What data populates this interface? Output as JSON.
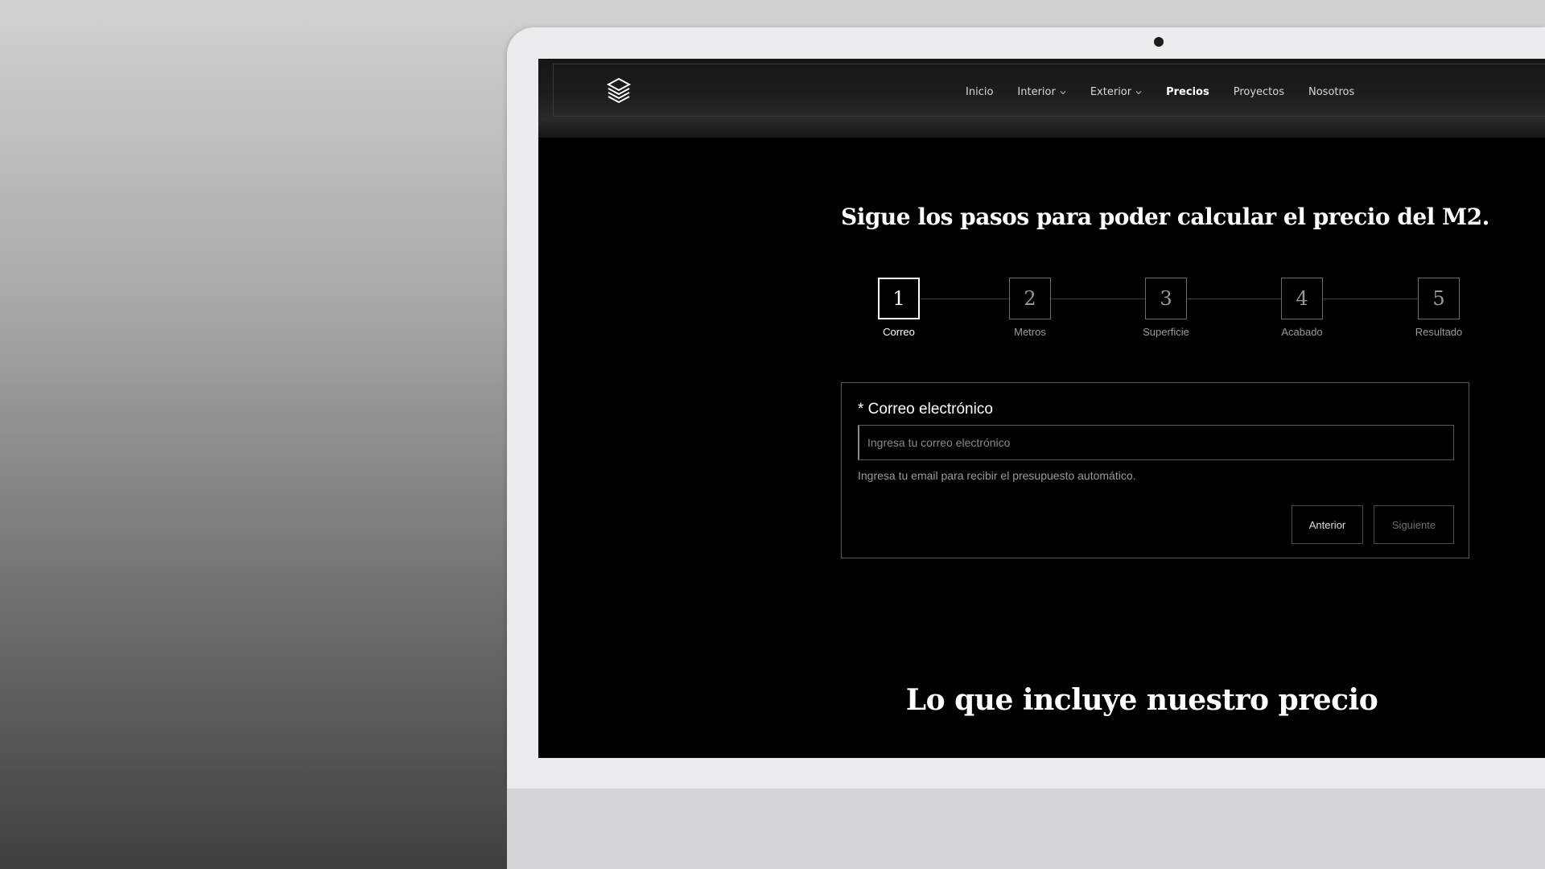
{
  "colors": {
    "screen_bg": "#000000",
    "text_primary": "#ffffff",
    "text_muted": "#9a9a9a",
    "border": "#5a5a5a",
    "laptop_bezel": "#ececee"
  },
  "icons": {
    "logo": "stacked-layers-icon",
    "dropdown": "chevron-down-icon"
  },
  "nav": {
    "items": [
      {
        "label": "Inicio"
      },
      {
        "label": "Interior"
      },
      {
        "label": "Exterior"
      },
      {
        "label": "Precios"
      },
      {
        "label": "Proyectos"
      },
      {
        "label": "Nosotros"
      }
    ]
  },
  "calculator": {
    "heading": "Sigue los pasos para poder calcular el precio del M2.",
    "steps": [
      {
        "number": "1",
        "label": "Correo"
      },
      {
        "number": "2",
        "label": "Metros"
      },
      {
        "number": "3",
        "label": "Superficie"
      },
      {
        "number": "4",
        "label": "Acabado"
      },
      {
        "number": "5",
        "label": "Resultado"
      }
    ],
    "form": {
      "label": "* Correo electrónico",
      "value": "",
      "placeholder": "Ingresa tu correo electrónico",
      "helper": "Ingresa tu email para recibir el presupuesto automático.",
      "prev_label": "Anterior",
      "next_label": "Siguiente"
    }
  },
  "includes": {
    "heading": "Lo que incluye nuestro precio"
  }
}
